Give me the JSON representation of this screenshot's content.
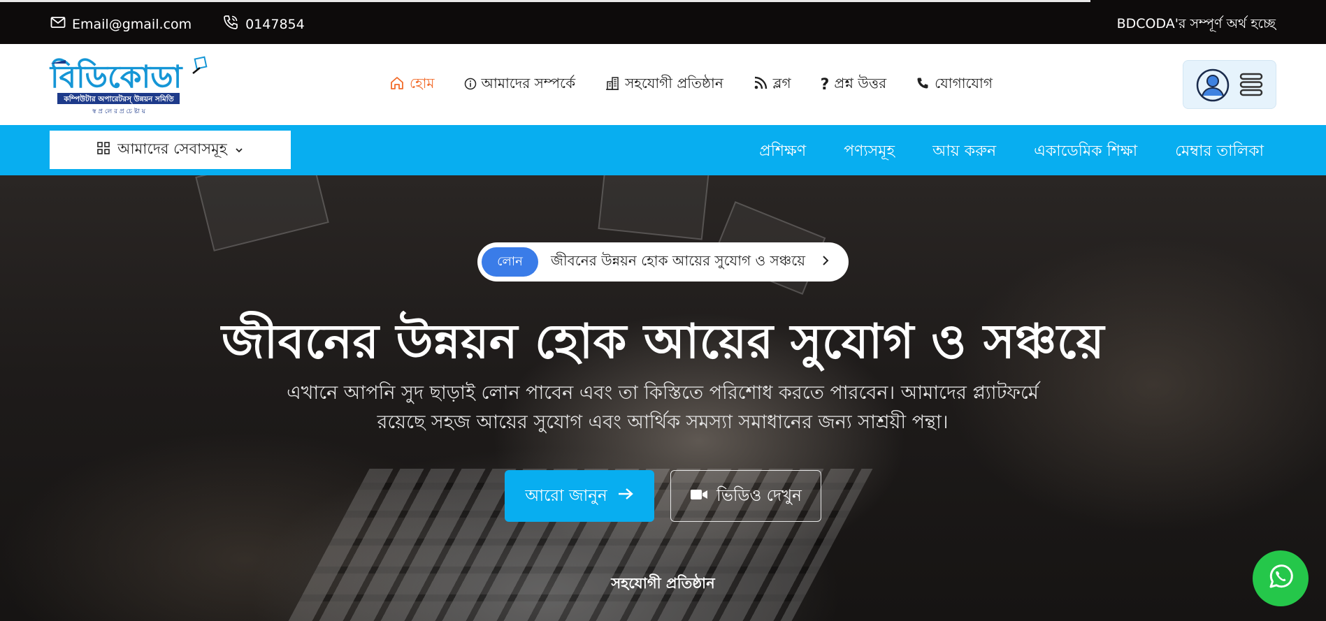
{
  "topbar": {
    "email": "Email@gmail.com",
    "phone": "0147854",
    "marquee": "BDCODA'র সম্পূর্ণ অর্থ হচ্ছে"
  },
  "header": {
    "logo": {
      "title": "বিডিকোডা",
      "tagline": "কম্পিউটার অপারেটরস্ উন্নয়ন সমিতি",
      "motto": "স্ব প্র লে র প্র চে ষ্টা য়"
    },
    "nav": [
      {
        "label": "হোম",
        "icon": "home-icon",
        "active": true
      },
      {
        "label": "আমাদের সম্পর্কে",
        "icon": "info-icon"
      },
      {
        "label": "সহযোগী প্রতিষ্ঠান",
        "icon": "building-icon"
      },
      {
        "label": "ব্লগ",
        "icon": "rss-icon"
      },
      {
        "label": "প্রশ্ন উত্তর",
        "icon": "question-icon"
      },
      {
        "label": "যোগাযোগ",
        "icon": "phone-icon"
      }
    ]
  },
  "servicebar": {
    "services_label": "আমাদের সেবাসমূহ",
    "links": [
      "প্রশিক্ষণ",
      "পণ্যসমূহ",
      "আয় করুন",
      "একাডেমিক শিক্ষা",
      "মেম্বার তালিকা"
    ]
  },
  "hero": {
    "pill_tag": "লোন",
    "pill_text": "জীবনের উন্নয়ন হোক আয়ের সুযোগ ও সঞ্চয়ে",
    "title": "জীবনের উন্নয়ন হোক আয়ের সুযোগ ও সঞ্চয়ে",
    "subtitle_line1": "এখানে আপনি সুদ ছাড়াই লোন পাবেন এবং তা কিস্তিতে পরিশোধ করতে পারবেন। আমাদের প্ল্যাটফর্মে",
    "subtitle_line2": "রয়েছে সহজ আয়ের সুযোগ এবং আর্থিক সমস্যা সমাধানের জন্য সাশ্রয়ী পন্থা।",
    "primary_button": "আরো জানুন",
    "secondary_button": "ভিডিও দেখুন",
    "partners_heading": "সহযোগী প্রতিষ্ঠান"
  },
  "colors": {
    "accent": "#08aef0",
    "active_nav": "#f26b2a",
    "topbar": "#0d0b0b",
    "pill_tag": "#3a7ce8",
    "whatsapp": "#25c74a"
  }
}
